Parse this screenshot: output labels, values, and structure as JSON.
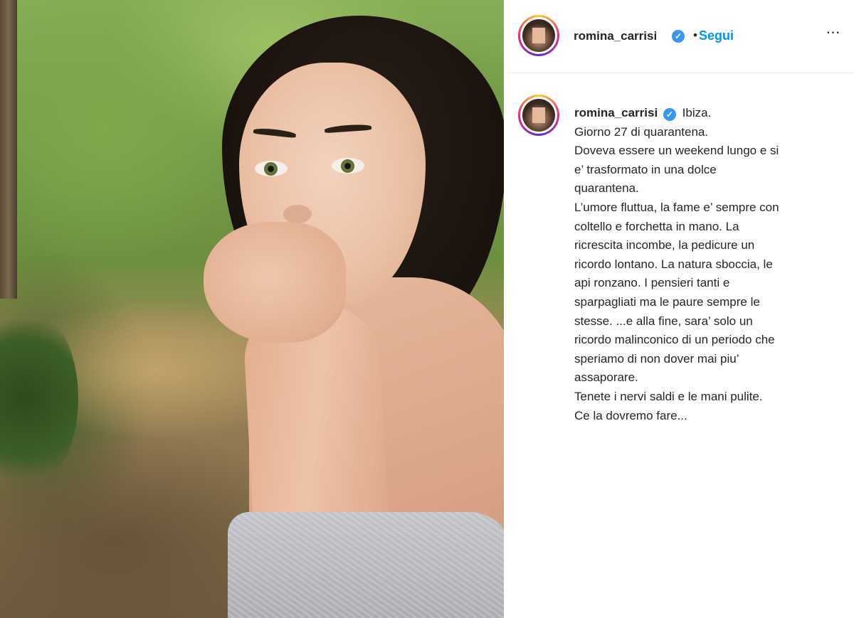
{
  "post": {
    "username": "romina_carrisi",
    "verified": true,
    "follow_label": "Segui",
    "separator": "•",
    "more_icon": "⋯"
  },
  "caption": {
    "username": "romina_carrisi",
    "lines": [
      "Ibiza.",
      "Giorno 27 di quarantena.",
      "Doveva essere un weekend lungo e si",
      "e’ trasformato in una dolce",
      "quarantena.",
      "L’umore fluttua, la fame e’ sempre con",
      "coltello e forchetta in mano. La",
      "ricrescita incombe, la pedicure un",
      "ricordo lontano. La natura sboccia, le",
      "api ronzano. I pensieri tanti e",
      "sparpagliati ma le paure sempre le",
      "stesse. ...e alla fine, sara’ solo un",
      "ricordo malinconico di un periodo che",
      "speriamo di non dover mai piu’",
      "assaporare.",
      "Tenete i nervi saldi e le mani pulite.",
      "Ce la dovremo fare..."
    ]
  },
  "colors": {
    "accent": "#0095f6",
    "verified_badge": "#3897f0",
    "text": "#262626",
    "divider": "#efefef"
  },
  "icons": {
    "verified": "verified-badge-icon",
    "more": "more-options-icon"
  }
}
